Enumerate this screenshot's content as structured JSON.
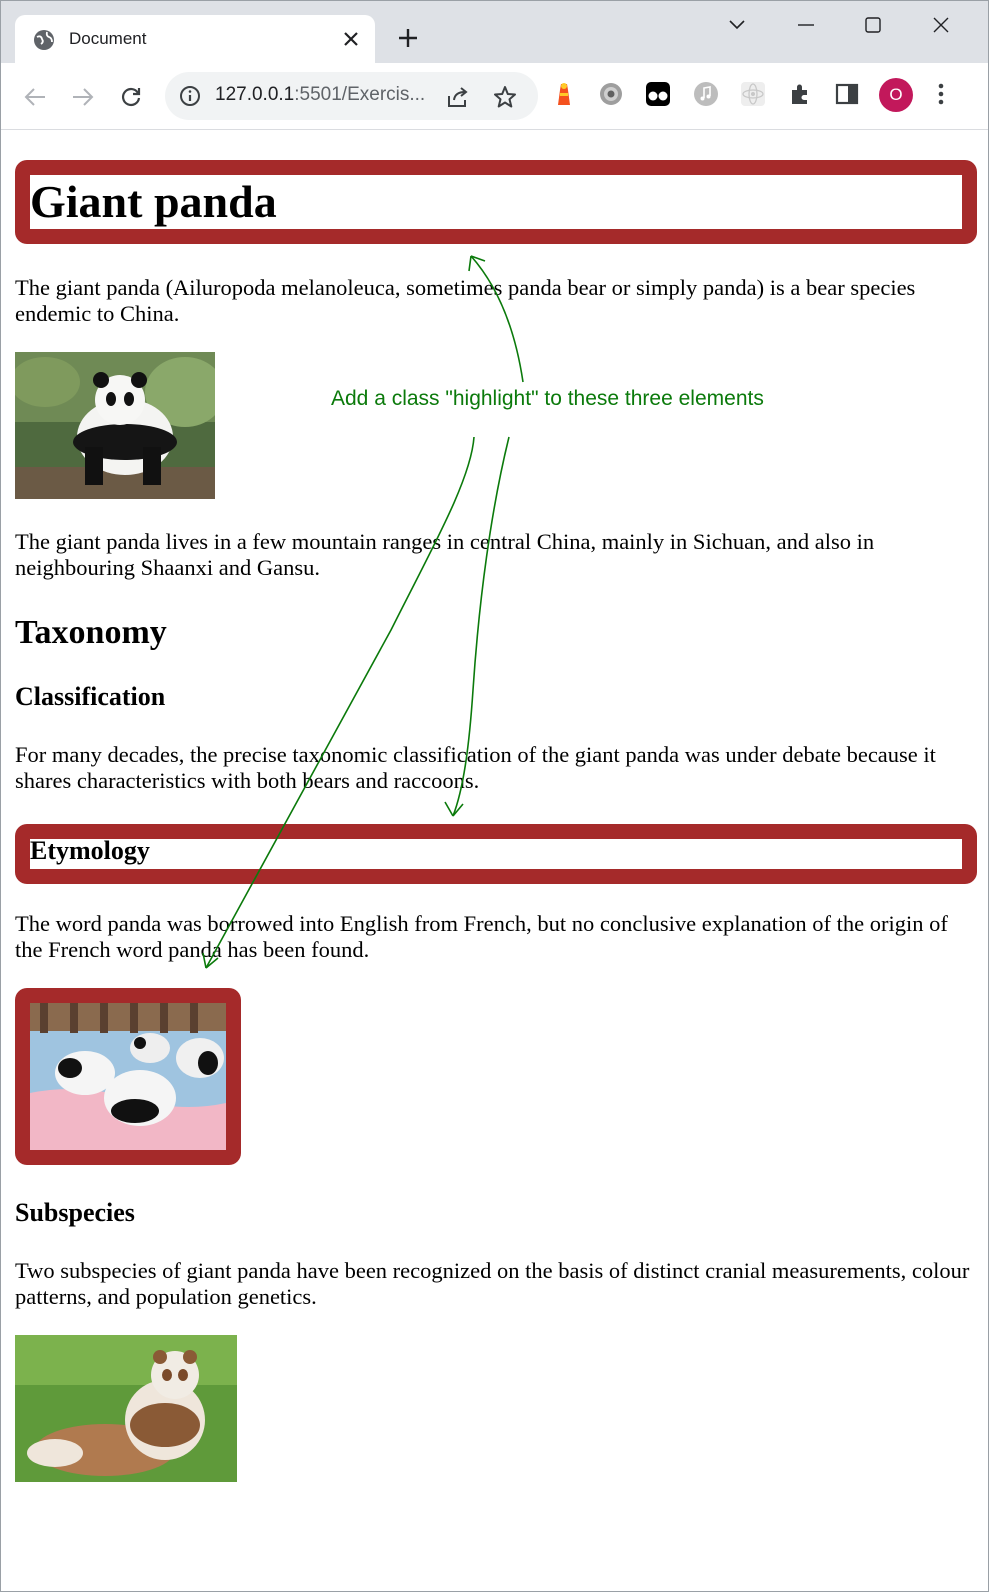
{
  "browser": {
    "tab_title": "Document",
    "url_host": "127.0.0.1",
    "url_rest": ":5501/Exercis...",
    "profile_initial": "O"
  },
  "page": {
    "title": "Giant panda",
    "intro": "The giant panda (Ailuropoda melanoleuca, sometimes panda bear or simply panda) is a bear species endemic to China.",
    "range": "The giant panda lives in a few mountain ranges in central China, mainly in Sichuan, and also in neighbouring Shaanxi and Gansu.",
    "taxonomy_heading": "Taxonomy",
    "classification_heading": "Classification",
    "classification_text": "For many decades, the precise taxonomic classification of the giant panda was under debate because it shares characteristics with both bears and raccoons.",
    "etymology_heading": "Etymology",
    "etymology_text": "The word panda was borrowed into English from French, but no conclusive explanation of the origin of the French word panda has been found.",
    "subspecies_heading": "Subspecies",
    "subspecies_text": "Two subspecies of giant panda have been recognized on the basis of distinct cranial measurements, colour patterns, and population genetics."
  },
  "annotation": {
    "text": "Add a class \"highlight\" to these three elements",
    "color": "#0b7a0b"
  },
  "colors": {
    "highlight_border": "#a52a2a",
    "profile": "#c2185b"
  }
}
